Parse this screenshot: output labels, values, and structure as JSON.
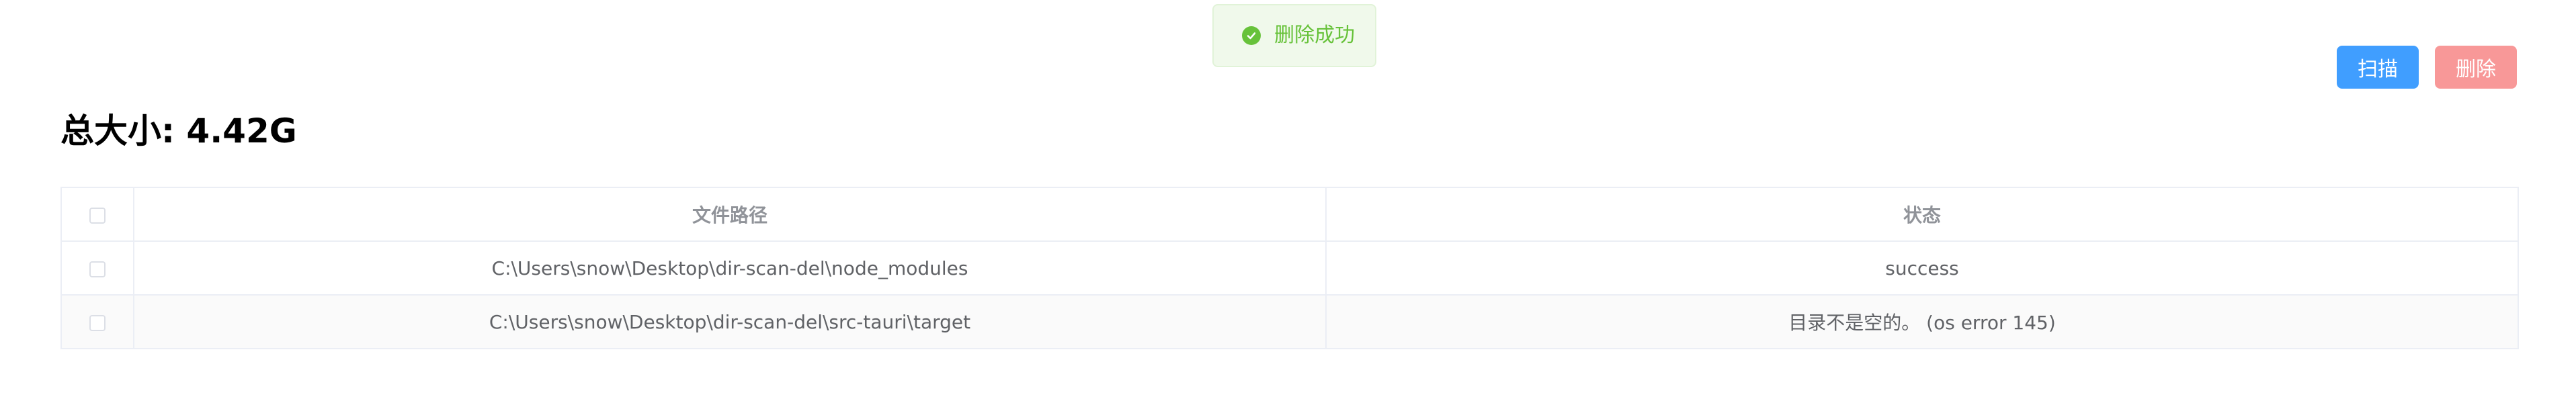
{
  "toast": {
    "message": "删除成功",
    "icon": "check-circle-icon",
    "color": "#67c23a"
  },
  "toolbar": {
    "scan_label": "扫描",
    "delete_label": "删除"
  },
  "summary": {
    "title": "总大小: 4.42G"
  },
  "table": {
    "headers": [
      "",
      "文件路径",
      "状态"
    ],
    "rows": [
      {
        "path": "C:\\Users\\snow\\Desktop\\dir-scan-del\\node_modules",
        "status": "success"
      },
      {
        "path": "C:\\Users\\snow\\Desktop\\dir-scan-del\\src-tauri\\target",
        "status": "目录不是空的。 (os error 145)"
      }
    ]
  },
  "colors": {
    "primary": "#409eff",
    "danger_disabled": "#f89898",
    "success": "#67c23a"
  }
}
